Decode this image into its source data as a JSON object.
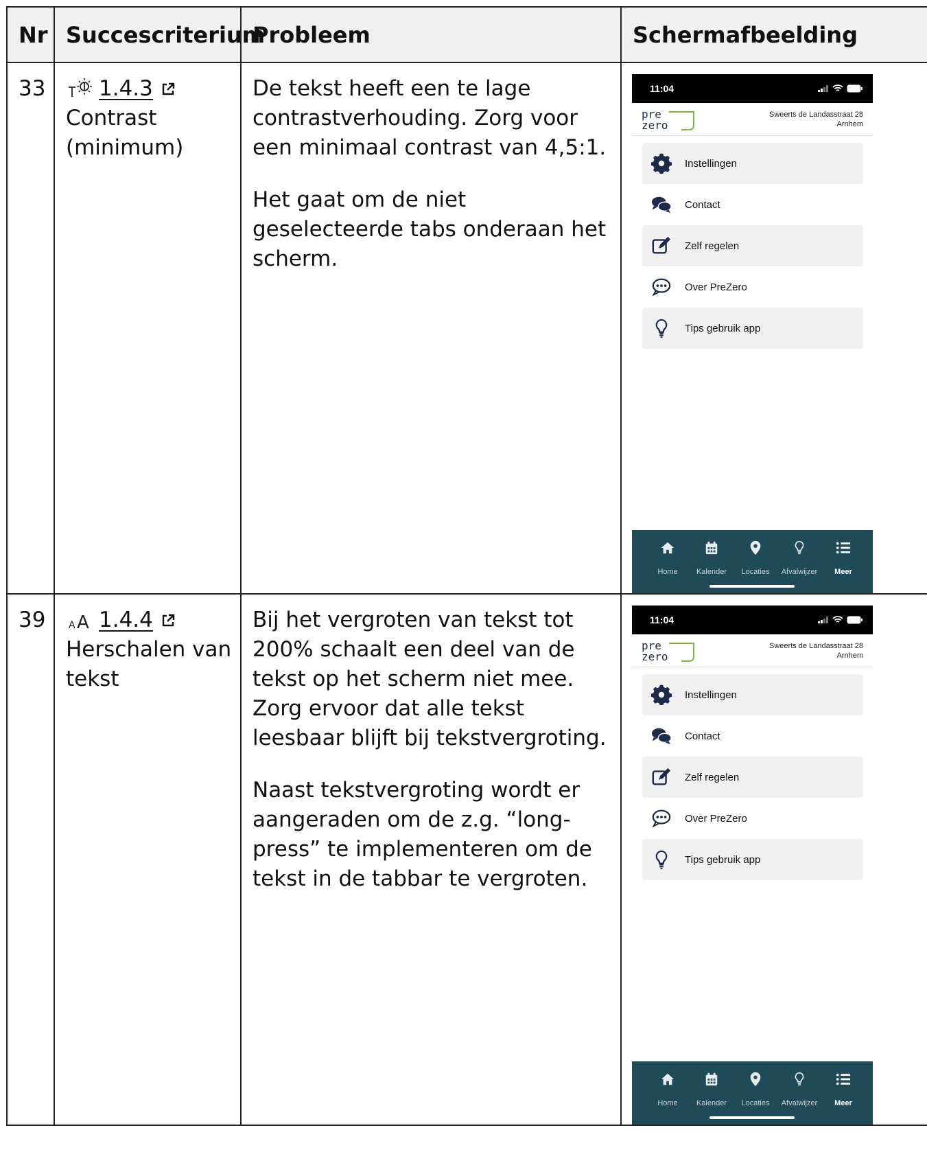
{
  "table": {
    "headers": {
      "nr": "Nr",
      "criterion": "Succescriterium",
      "problem": "Probleem",
      "screenshot": "Schermafbeelding"
    },
    "rows": [
      {
        "nr": "33",
        "criterion_icon": "contrast-icon",
        "criterion_ref": "1.4.3",
        "criterion_name": "Contrast (minimum)",
        "problem": [
          "De tekst heeft een te lage contrastverhouding. Zorg voor een minimaal contrast van 4,5:1.",
          "Het gaat om de niet geselecteerde tabs onderaan het scherm."
        ]
      },
      {
        "nr": "39",
        "criterion_icon": "resize-text-icon",
        "criterion_ref": "1.4.4",
        "criterion_name": "Herschalen van tekst",
        "problem": [
          "Bij het vergroten van tekst tot 200% schaalt een deel van de tekst op het scherm niet mee. Zorg ervoor dat alle tekst leesbaar blijft bij tekstvergroting.",
          "Naast tekstvergroting wordt er aangeraden om de z.g. “long-press” te implementeren om de tekst in de tabbar te vergroten."
        ]
      }
    ]
  },
  "phone": {
    "time": "11:04",
    "logo_top": "pre",
    "logo_bottom": "zero",
    "address_line1": "Sweerts de Landasstraat 28",
    "address_line2": "Arnhem",
    "menu": [
      {
        "label": "Instellingen",
        "icon": "gear-icon"
      },
      {
        "label": "Contact",
        "icon": "chat-icon"
      },
      {
        "label": "Zelf regelen",
        "icon": "edit-icon"
      },
      {
        "label": "Over PreZero",
        "icon": "speech-dots-icon"
      },
      {
        "label": "Tips gebruik app",
        "icon": "lightbulb-icon"
      }
    ],
    "tabs": [
      {
        "label": "Home",
        "icon": "home-icon"
      },
      {
        "label": "Kalender",
        "icon": "calendar-icon"
      },
      {
        "label": "Locaties",
        "icon": "location-pin-icon"
      },
      {
        "label": "Afvalwijzer",
        "icon": "lightbulb-icon"
      },
      {
        "label": "Meer",
        "icon": "list-icon",
        "active": true
      }
    ],
    "colors": {
      "tabbar": "#1f4a57",
      "logo_green": "#7ab648",
      "icon_navy": "#1d2a4a"
    }
  }
}
